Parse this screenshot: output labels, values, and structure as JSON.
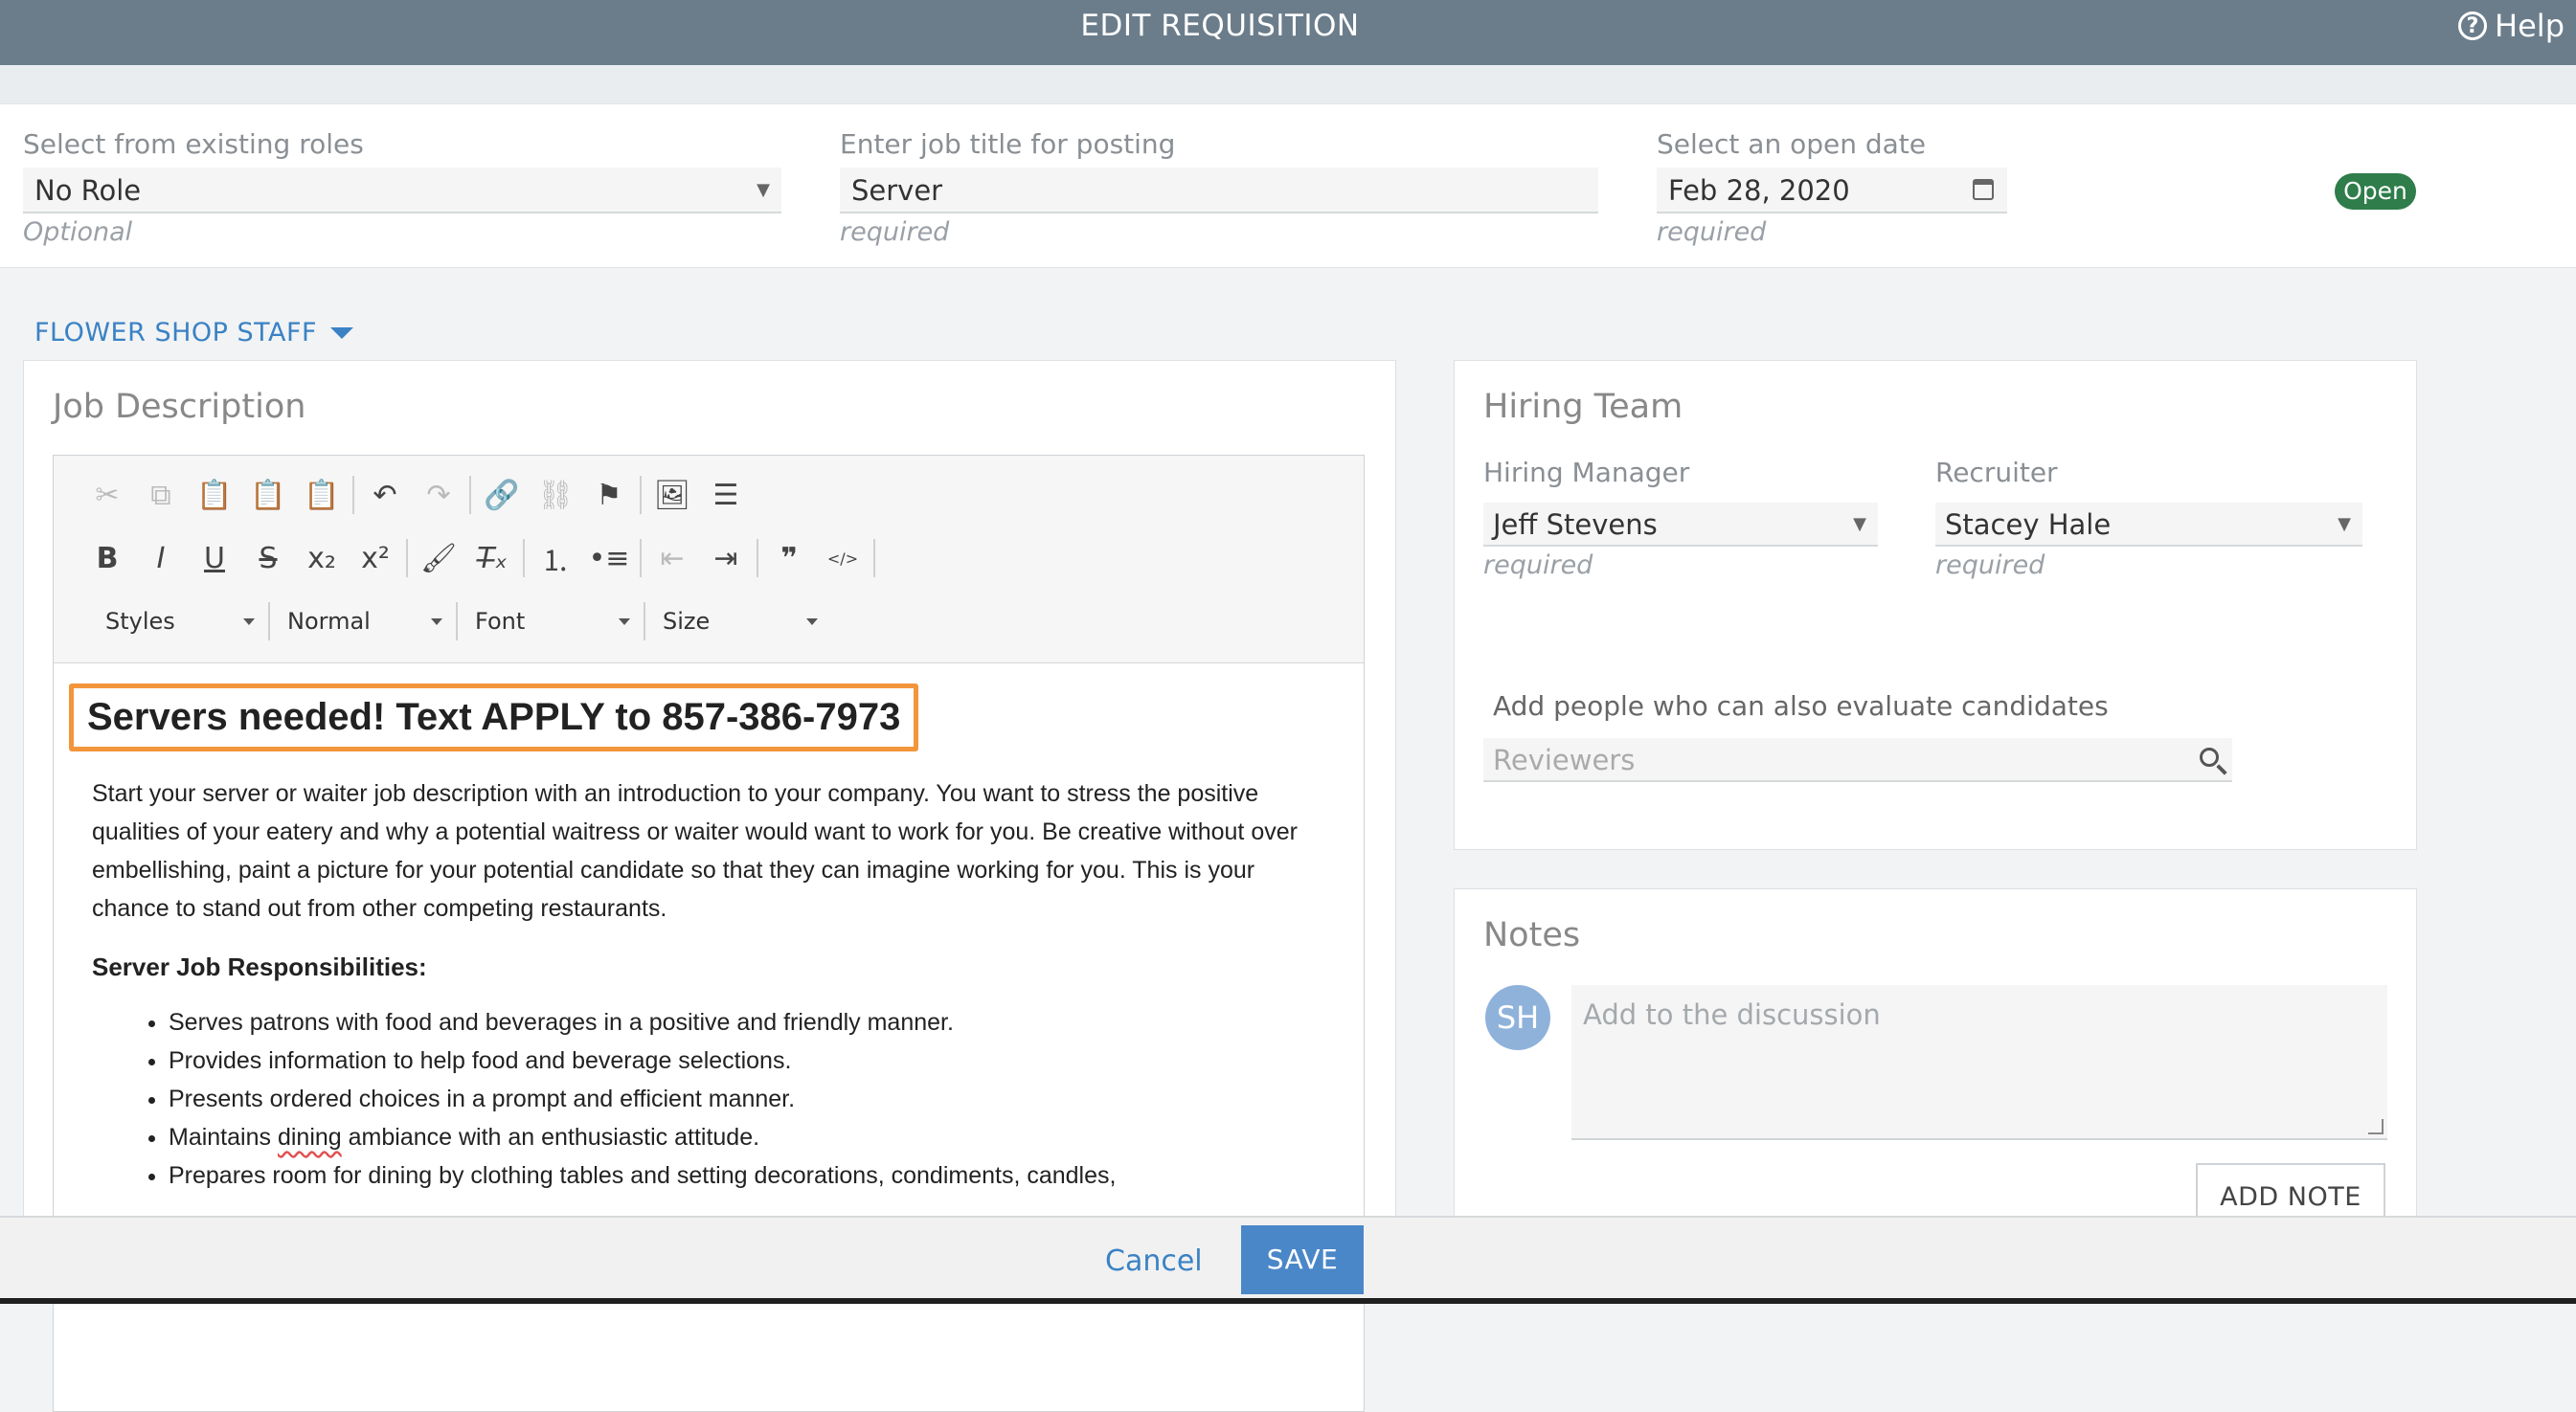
{
  "header": {
    "title": "EDIT REQUISITION",
    "help_label": "Help",
    "help_glyph": "?"
  },
  "form": {
    "role": {
      "label": "Select from existing roles",
      "value": "No Role",
      "hint": "Optional"
    },
    "job_title": {
      "label": "Enter job title for posting",
      "value": "Server",
      "hint": "required"
    },
    "open_date": {
      "label": "Select an open date",
      "value": "Feb 28, 2020",
      "hint": "required"
    },
    "status_badge": "Open"
  },
  "group": {
    "name": "FLOWER SHOP STAFF"
  },
  "job_description": {
    "title": "Job Description",
    "toolbar": {
      "styles": "Styles",
      "format": "Normal",
      "font": "Font",
      "size": "Size"
    },
    "headline": "Servers needed! Text APPLY to 857-386-7973",
    "intro": "Start your server or waiter job description with an introduction to your company. You want to stress the positive qualities of your eatery and why a potential waitress or waiter would want to work for you. Be creative without over embellishing, paint a picture for your potential candidate so that they can imagine working for you. This is your chance to stand out from other competing restaurants.",
    "responsibilities_title": "Server Job Responsibilities:",
    "responsibilities": [
      "Serves patrons with food and beverages in a positive and friendly manner.",
      "Provides information to help food and beverage selections.",
      "Presents ordered choices in a prompt and efficient manner.",
      "Prepares room for dining by clothing tables and setting decorations, condiments, candles,"
    ],
    "resp4": {
      "before": "Maintains ",
      "flagged": "dining",
      "after": " ambiance with an enthusiastic attitude."
    }
  },
  "hiring_team": {
    "title": "Hiring Team",
    "manager": {
      "label": "Hiring Manager",
      "value": "Jeff Stevens",
      "hint": "required"
    },
    "recruiter": {
      "label": "Recruiter",
      "value": "Stacey Hale",
      "hint": "required"
    },
    "reviewers": {
      "label": "Add people who can also evaluate candidates",
      "placeholder": "Reviewers"
    }
  },
  "notes": {
    "title": "Notes",
    "avatar_initials": "SH",
    "placeholder": "Add to the discussion",
    "add_button": "ADD NOTE"
  },
  "footer": {
    "cancel_label": "Cancel",
    "save_label": "SAVE"
  },
  "icons": {
    "toolbar_row1": [
      "cut-icon",
      "copy-icon",
      "paste-icon",
      "paste-text-icon",
      "paste-word-icon",
      "undo-icon",
      "redo-icon",
      "link-icon",
      "unlink-icon",
      "anchor-flag-icon",
      "image-icon",
      "horizontal-rule-icon"
    ],
    "toolbar_row2": [
      "bold-icon",
      "italic-icon",
      "underline-icon",
      "strikethrough-icon",
      "subscript-icon",
      "superscript-icon",
      "copy-format-icon",
      "remove-format-icon",
      "numbered-list-icon",
      "bullet-list-icon",
      "outdent-icon",
      "indent-icon",
      "blockquote-icon",
      "div-icon"
    ]
  },
  "colors": {
    "header_bg": "#6b7d8b",
    "accent": "#3a82c4",
    "badge_open": "#2e7d4a",
    "highlight": "#f2953b",
    "save_bg": "#4a87c8"
  }
}
